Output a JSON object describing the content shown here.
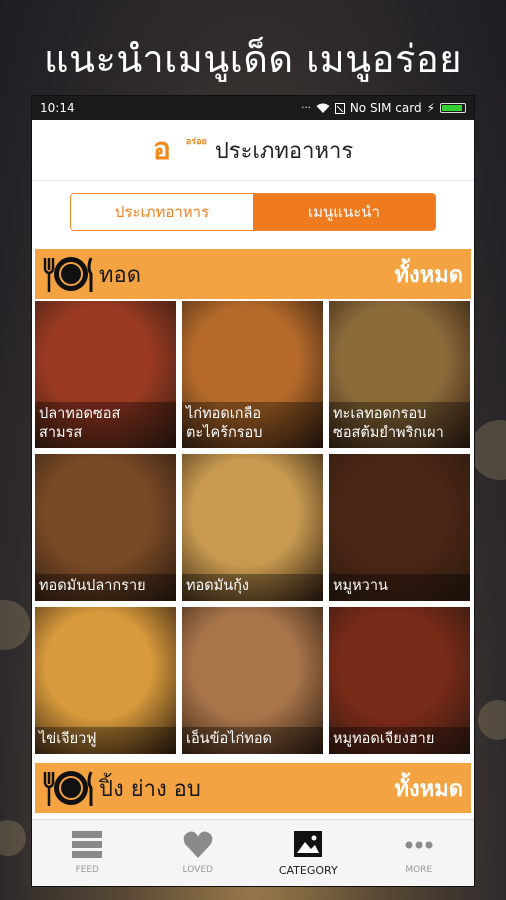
{
  "promo": {
    "headline": "แนะนำเมนูเด็ด เมนูอร่อย"
  },
  "status_bar": {
    "time": "10:14",
    "carrier": "No SIM card"
  },
  "header": {
    "logo_text": "อ",
    "logo_small": "อร่อย",
    "title": "ประเภทอาหาร"
  },
  "segments": {
    "first": "ประเภทอาหาร",
    "second": "เมนูแนะนำ",
    "active_index": 1
  },
  "sections": [
    {
      "name": "ทอด",
      "see_all": "ทั้งหมด",
      "items": [
        {
          "caption": "ปลาทอดซอส\nสามรส",
          "color": "#9a3a22"
        },
        {
          "caption": "ไก่ทอดเกลือ\nตะไคร้กรอบ",
          "color": "#b56a2a"
        },
        {
          "caption": "ทะเลทอดกรอบ\nซอสต้มยำพริกเผา",
          "color": "#8c6a3a"
        },
        {
          "caption": "ทอดมันปลากราย",
          "color": "#7a4a26"
        },
        {
          "caption": "ทอดมันกุ้ง",
          "color": "#c89a50"
        },
        {
          "caption": "หมูหวาน",
          "color": "#4a2614"
        },
        {
          "caption": "ไข่เจียวฟู",
          "color": "#d89a3c"
        },
        {
          "caption": "เอ็นข้อไก่ทอด",
          "color": "#a8744a"
        },
        {
          "caption": "หมูทอดเจียงฮาย",
          "color": "#7a2a18"
        }
      ]
    },
    {
      "name": "ปิ้ง ย่าง อบ",
      "see_all": "ทั้งหมด"
    }
  ],
  "tabs": [
    {
      "label": "FEED",
      "icon": "feed-icon"
    },
    {
      "label": "LOVED",
      "icon": "heart-icon"
    },
    {
      "label": "CATEGORY",
      "icon": "image-icon"
    },
    {
      "label": "MORE",
      "icon": "more-icon"
    }
  ],
  "colors": {
    "accent": "#f07b1f",
    "section_bar": "#f4a342"
  }
}
